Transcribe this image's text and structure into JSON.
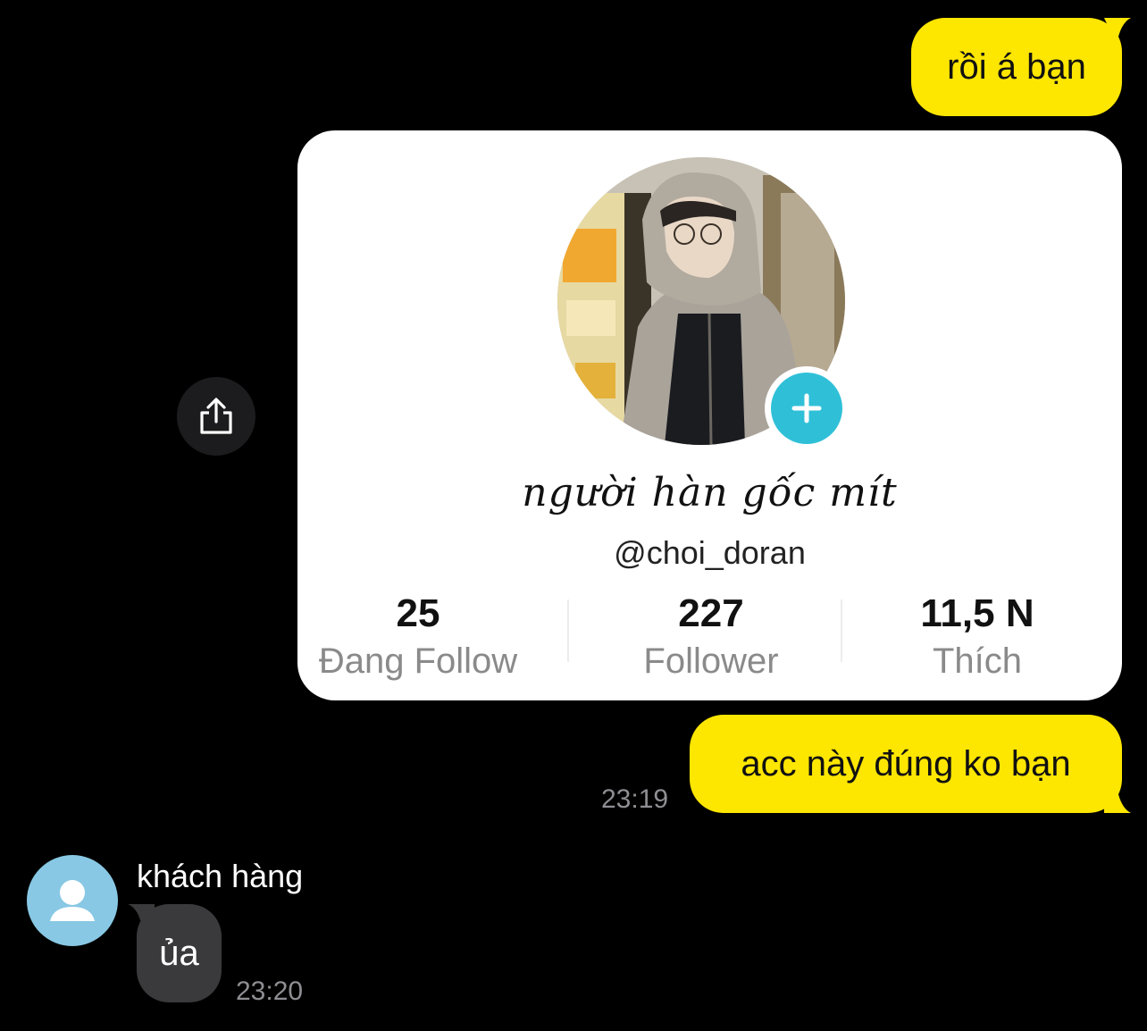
{
  "messages": {
    "out_1": "rồi á bạn",
    "out_2": "acc này đúng ko bạn",
    "out_time": "23:19",
    "in_sender": "khách hàng",
    "in_1": "ủa",
    "in_time": "23:20"
  },
  "profile_card": {
    "display_name": "người hàn gốc mít",
    "handle": "@choi_doran",
    "stats": [
      {
        "value": "25",
        "label": "Đang Follow"
      },
      {
        "value": "227",
        "label": "Follower"
      },
      {
        "value": "11,5 N",
        "label": "Thích"
      }
    ]
  },
  "icons": {
    "share": "share-icon",
    "plus": "plus-icon",
    "avatar_placeholder": "person-icon"
  },
  "colors": {
    "outgoing_bubble": "#fde600",
    "incoming_bubble": "#3a3a3c",
    "follow_plus": "#2fc0d8",
    "placeholder_avatar": "#88c8e4",
    "background": "#000000"
  }
}
